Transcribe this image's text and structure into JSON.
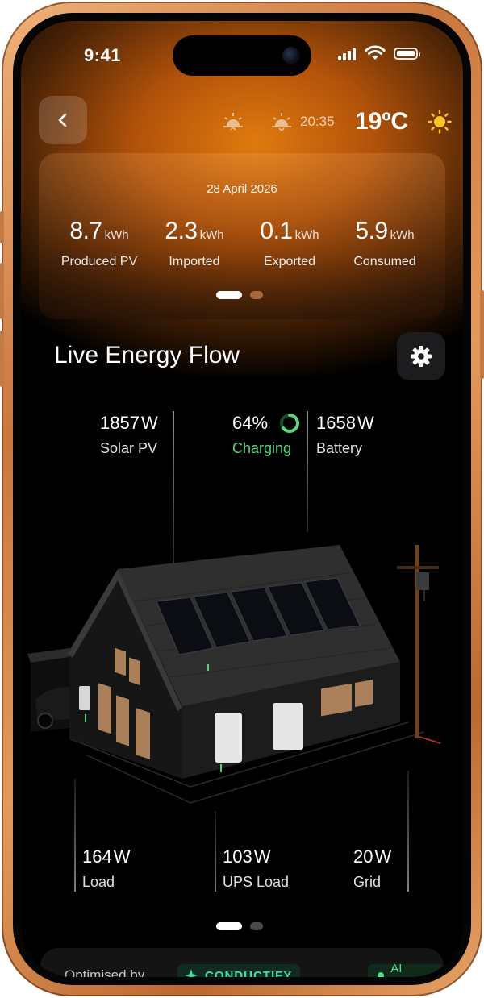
{
  "status_bar": {
    "time": "9:41"
  },
  "weather": {
    "time": "20:35",
    "temperature": "19ºC"
  },
  "summary": {
    "date": "28 April 2026",
    "stats": [
      {
        "value": "8.7",
        "unit": "kWh",
        "label": "Produced PV"
      },
      {
        "value": "2.3",
        "unit": "kWh",
        "label": "Imported"
      },
      {
        "value": "0.1",
        "unit": "kWh",
        "label": "Exported"
      },
      {
        "value": "5.9",
        "unit": "kWh",
        "label": "Consumed"
      }
    ]
  },
  "live": {
    "title": "Live Energy Flow",
    "solar": {
      "value": "1857",
      "unit": "W",
      "label": "Solar PV"
    },
    "charge": {
      "percent": "64%",
      "status": "Charging",
      "level": 0.64
    },
    "battery": {
      "value": "1658",
      "unit": "W",
      "label": "Battery"
    },
    "load": {
      "value": "164",
      "unit": "W",
      "label": "Load"
    },
    "ups": {
      "value": "103",
      "unit": "W",
      "label": "UPS Load"
    },
    "grid": {
      "value": "20",
      "unit": "W",
      "label": "Grid"
    }
  },
  "footer": {
    "optimised_by": "Optimised by",
    "brand": "CONDUCTIFY",
    "ai_status": "AI Active"
  },
  "colors": {
    "accent_orange": "#e07a0f",
    "charging_green": "#58d37a",
    "brand_green": "#3fe0a5"
  },
  "icons": [
    "chevron-left-icon",
    "sunrise-icon",
    "sunset-icon",
    "sun-icon",
    "gear-icon",
    "sparkle-icon",
    "signal-icon",
    "wifi-icon",
    "battery-icon"
  ]
}
